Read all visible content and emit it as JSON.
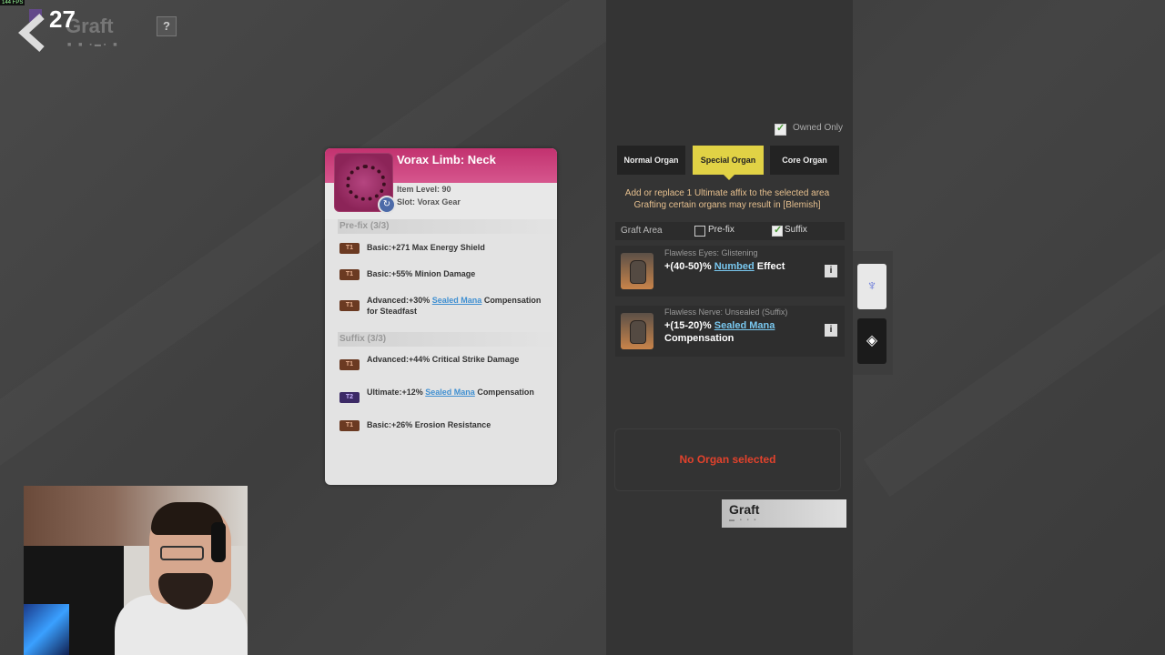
{
  "header": {
    "fps": "144 FPS",
    "level": "27",
    "title": "Graft",
    "help": "?"
  },
  "item": {
    "name": "Vorax Limb: Neck",
    "item_level": "Item Level: 90",
    "slot": "Slot: Vorax Gear",
    "prefix_header": "Pre-fix (3/3)",
    "suffix_header": "Suffix (3/3)",
    "prefixes": [
      {
        "tier": "T1",
        "text": "Basic:+271 Max Energy Shield"
      },
      {
        "tier": "T1",
        "text": "Basic:+55% Minion Damage"
      },
      {
        "tier": "T1",
        "pre": "Advanced:+30% ",
        "hl": "Sealed Mana",
        "post": " Compensation for Steadfast"
      }
    ],
    "suffixes": [
      {
        "tier": "T1",
        "text": "Advanced:+44% Critical Strike Damage"
      },
      {
        "tier": "T2",
        "pre": "Ultimate:+12% ",
        "hl": "Sealed Mana",
        "post": " Compensation"
      },
      {
        "tier": "T1",
        "text": "Basic:+26% Erosion Resistance"
      }
    ]
  },
  "panel": {
    "owned_only": "Owned Only",
    "tabs": {
      "normal": "Normal Organ",
      "special": "Special Organ",
      "core": "Core Organ"
    },
    "desc_line1": "Add or replace 1 Ultimate affix to the selected area",
    "desc_line2": "Grafting certain organs may result in [Blemish]",
    "graft_area": "Graft Area",
    "prefix_label": "Pre-fix",
    "suffix_label": "Suffix",
    "organs": [
      {
        "name": "Flawless Eyes: Glistening",
        "pre": "+(40-50)% ",
        "hl": "Numbed",
        "post": " Effect"
      },
      {
        "name": "Flawless Nerve: Unsealed (Suffix)",
        "pre": "+(15-20)% ",
        "hl": "Sealed Mana",
        "post": " Compensation"
      }
    ],
    "info": "i",
    "no_organ": "No Organ selected",
    "graft_button": "Graft"
  },
  "icons": [
    "back-arrow-icon",
    "necklace-icon",
    "refresh-icon",
    "organ-jar-icon",
    "wing-emblem-icon",
    "diamond-arrow-icon"
  ],
  "colors": {
    "accent_yellow": "#e1d245",
    "rarity_pink": "#c2326f",
    "warning_red": "#e2422c",
    "highlight_blue": "#3f8fd1"
  }
}
